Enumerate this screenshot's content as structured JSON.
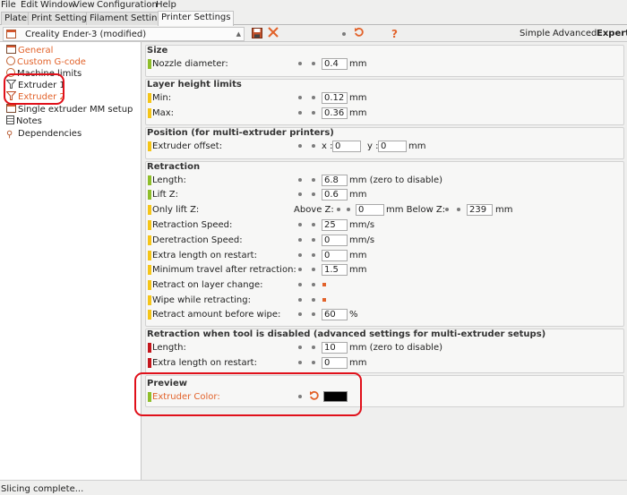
{
  "menu": [
    "File",
    "Edit",
    "Window",
    "View",
    "Configuration",
    "Help"
  ],
  "tabs": [
    "Plater",
    "Print Settings",
    "Filament Settings",
    "Printer Settings"
  ],
  "toolbar": {
    "preset": "Creality Ender-3 (modified)",
    "modes": [
      "Simple",
      "Advanced",
      "Expert"
    ],
    "help": "?"
  },
  "sidebar": [
    {
      "label": "General",
      "icon": "printer-window-icon",
      "color": "#e2622a"
    },
    {
      "label": "Custom G-code",
      "icon": "gear-icon",
      "color": "#e2622a"
    },
    {
      "label": "Machine limits",
      "icon": "gear-icon",
      "color": "#222"
    },
    {
      "label": "Extruder 1",
      "icon": "extruder-funnel-icon",
      "color": "#222"
    },
    {
      "label": "Extruder 2",
      "icon": "extruder-funnel-icon",
      "color": "#e2622a"
    },
    {
      "label": "Single extruder MM setup",
      "icon": "printer-window-icon",
      "color": "#222"
    },
    {
      "label": "Notes",
      "icon": "notes-icon",
      "color": "#222"
    },
    {
      "label": "Dependencies",
      "icon": "dependencies-icon",
      "color": "#222"
    }
  ],
  "groups": {
    "size": {
      "title": "Size",
      "nozzle_label": "Nozzle diameter:",
      "nozzle_value": "0.4",
      "nozzle_unit": "mm"
    },
    "layer": {
      "title": "Layer height limits",
      "min_label": "Min:",
      "min_value": "0.12",
      "min_unit": "mm",
      "max_label": "Max:",
      "max_value": "0.36",
      "max_unit": "mm"
    },
    "position": {
      "title": "Position (for multi-extruder printers)",
      "offset_label": "Extruder offset:",
      "x_label": "x :",
      "x_value": "0",
      "y_label": "y :",
      "y_value": "0",
      "unit": "mm"
    },
    "retraction": {
      "title": "Retraction",
      "length_label": "Length:",
      "length_value": "6.8",
      "length_unit": "mm (zero to disable)",
      "liftz_label": "Lift Z:",
      "liftz_value": "0.6",
      "liftz_unit": "mm",
      "onlylift_label": "Only lift Z:",
      "above_label": "Above Z:",
      "above_value": "0",
      "below_label": "mm Below Z:",
      "below_value": "239",
      "below_unit": "mm",
      "speed_label": "Retraction Speed:",
      "speed_value": "25",
      "speed_unit": "mm/s",
      "despeed_label": "Deretraction Speed:",
      "despeed_value": "0",
      "despeed_unit": "mm/s",
      "extra_label": "Extra length on restart:",
      "extra_value": "0",
      "extra_unit": "mm",
      "mintravel_label": "Minimum travel after retraction:",
      "mintravel_value": "1.5",
      "mintravel_unit": "mm",
      "layerchange_label": "Retract on layer change:",
      "wipe_label": "Wipe while retracting:",
      "wipeamount_label": "Retract amount before wipe:",
      "wipeamount_value": "60",
      "wipeamount_unit": "%"
    },
    "toolchange": {
      "title": "Retraction when tool is disabled (advanced settings for multi-extruder setups)",
      "length_label": "Length:",
      "length_value": "10",
      "length_unit": "mm (zero to disable)",
      "extra_label": "Extra length on restart:",
      "extra_value": "0",
      "extra_unit": "mm"
    },
    "preview": {
      "title": "Preview",
      "color_label": "Extruder Color:",
      "color_value": "#000000"
    }
  },
  "status": "Slicing complete..."
}
